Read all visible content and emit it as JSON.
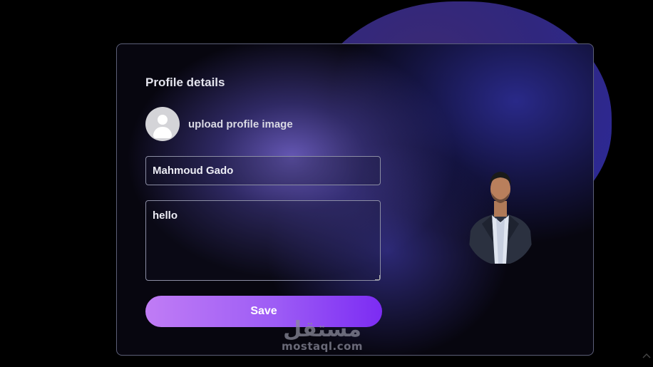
{
  "profile": {
    "title": "Profile details",
    "upload_label": "upload profile image",
    "name_value": "Mahmoud Gado",
    "bio_value": "hello",
    "save_label": "Save"
  },
  "watermark": {
    "arabic": "مستقل",
    "latin": "mostaql.com"
  },
  "icons": {
    "avatar": "user-avatar-icon"
  },
  "colors": {
    "background": "#000000",
    "card_border": "#5c5f78",
    "button_start": "#c07cf5",
    "button_end": "#7c2cf3",
    "blob": "#30277e"
  }
}
